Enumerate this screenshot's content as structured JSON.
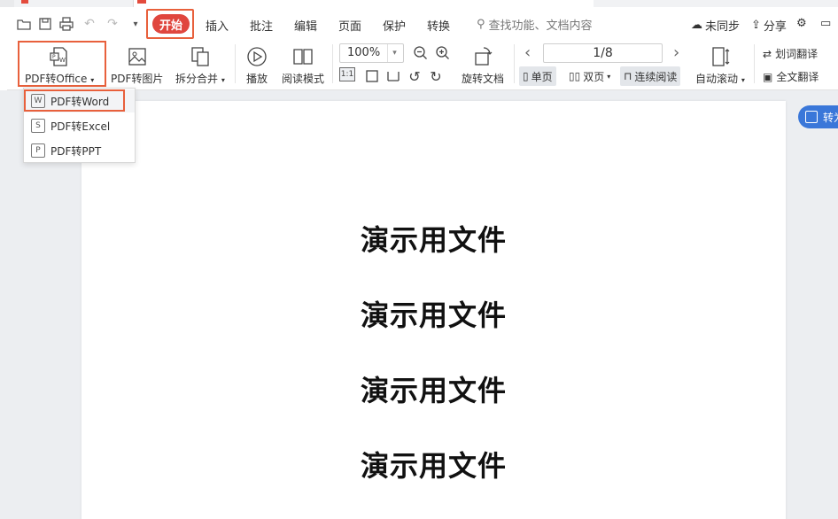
{
  "menubar": {
    "start": "开始",
    "items": [
      "插入",
      "批注",
      "编辑",
      "页面",
      "保护",
      "转换"
    ],
    "search_placeholder": "查找功能、文档内容",
    "sync": "未同步",
    "share": "分享"
  },
  "ribbon": {
    "pdf_to_office": "PDF转Office",
    "pdf_to_image": "PDF转图片",
    "split_merge": "拆分合并",
    "play": "播放",
    "read_mode": "阅读模式",
    "zoom": "100%",
    "rotate_doc": "旋转文档",
    "page_indicator": "1/8",
    "single_page": "单页",
    "double_page": "双页",
    "continuous_read": "连续阅读",
    "auto_scroll": "自动滚动",
    "word_translate": "划词翻译",
    "full_translate": "全文翻译",
    "fit_label": "1:1"
  },
  "dropdown": {
    "items": [
      "PDF转Word",
      "PDF转Excel",
      "PDF转PPT"
    ],
    "selected_index": 0
  },
  "document": {
    "lines": [
      "演示用文件",
      "演示用文件",
      "演示用文件",
      "演示用文件"
    ]
  },
  "float_button": "转为",
  "colors": {
    "accent_red": "#e0463e",
    "highlight_orange": "#e8603c",
    "float_blue": "#3a77d9"
  }
}
